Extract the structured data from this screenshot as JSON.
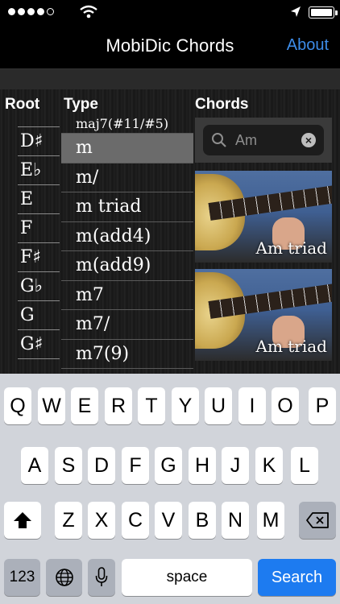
{
  "status_bar": {
    "signal_dots_filled": 4,
    "signal_dots_total": 5,
    "battery_level": 1.0
  },
  "nav": {
    "title": "MobiDic Chords",
    "about_label": "About"
  },
  "columns": {
    "root_header": "Root",
    "type_header": "Type",
    "chords_header": "Chords"
  },
  "root_items": [
    "D♯",
    "E♭",
    "E",
    "F",
    "F♯",
    "G♭",
    "G",
    "G♯"
  ],
  "type_items": [
    {
      "label": "m",
      "selected": true
    },
    {
      "label": "m/",
      "selected": false
    },
    {
      "label": "m triad",
      "selected": false
    },
    {
      "label": "m(add4)",
      "selected": false
    },
    {
      "label": "m(add9)",
      "selected": false
    },
    {
      "label": "m7",
      "selected": false
    },
    {
      "label": "m7/",
      "selected": false
    },
    {
      "label": "m7(9)",
      "selected": false
    }
  ],
  "type_partial_top": "maj7(#11/#5)",
  "search": {
    "value": "Am",
    "icon": "search-icon",
    "clear_icon": "clear-icon"
  },
  "chord_results": [
    {
      "caption": "Am triad"
    },
    {
      "caption": "Am triad"
    }
  ],
  "keyboard": {
    "row1": [
      "Q",
      "W",
      "E",
      "R",
      "T",
      "Y",
      "U",
      "I",
      "O",
      "P"
    ],
    "row2": [
      "A",
      "S",
      "D",
      "F",
      "G",
      "H",
      "J",
      "K",
      "L"
    ],
    "row3": [
      "Z",
      "X",
      "C",
      "V",
      "B",
      "N",
      "M"
    ],
    "numbers_label": "123",
    "space_label": "space",
    "search_label": "Search",
    "colors": {
      "search_key": "#1d7bf0",
      "dark_key": "#abb0ba",
      "light_key": "#ffffff"
    }
  },
  "colors": {
    "accent": "#3d8ce8",
    "selected_row": "#6b6b6b"
  }
}
